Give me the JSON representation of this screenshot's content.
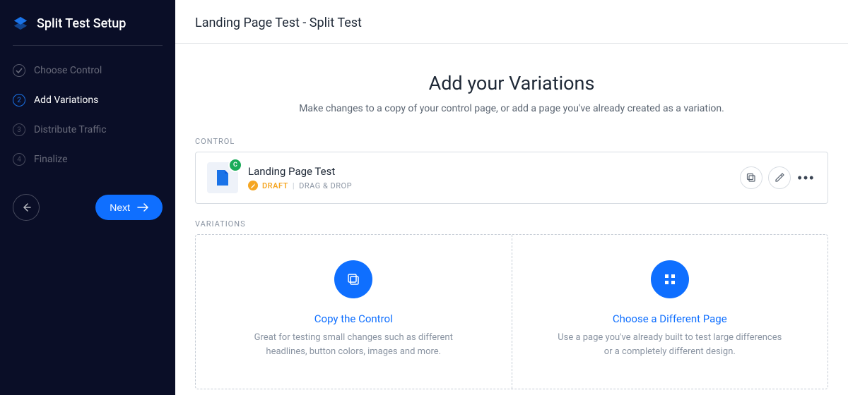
{
  "sidebar": {
    "title": "Split Test Setup",
    "steps": [
      {
        "label": "Choose Control",
        "state": "done",
        "num": "✓"
      },
      {
        "label": "Add Variations",
        "state": "active",
        "num": "2"
      },
      {
        "label": "Distribute Traffic",
        "state": "pending",
        "num": "3"
      },
      {
        "label": "Finalize",
        "state": "pending",
        "num": "4"
      }
    ],
    "next_label": "Next"
  },
  "header": {
    "title": "Landing Page Test - Split Test"
  },
  "main": {
    "heading": "Add your Variations",
    "subheading": "Make changes to a copy of your control page, or add a page you've already created as a variation.",
    "control_label": "CONTROL",
    "variations_label": "VARIATIONS"
  },
  "control": {
    "name": "Landing Page Test",
    "badge": "C",
    "status": "DRAFT",
    "type": "DRAG & DROP",
    "separator": "|"
  },
  "options": {
    "copy": {
      "title": "Copy the Control",
      "desc": "Great for testing small changes such as different headlines, button colors, images and more."
    },
    "choose": {
      "title": "Choose a Different Page",
      "desc": "Use a page you've already built to test large differences or a completely different design."
    }
  }
}
